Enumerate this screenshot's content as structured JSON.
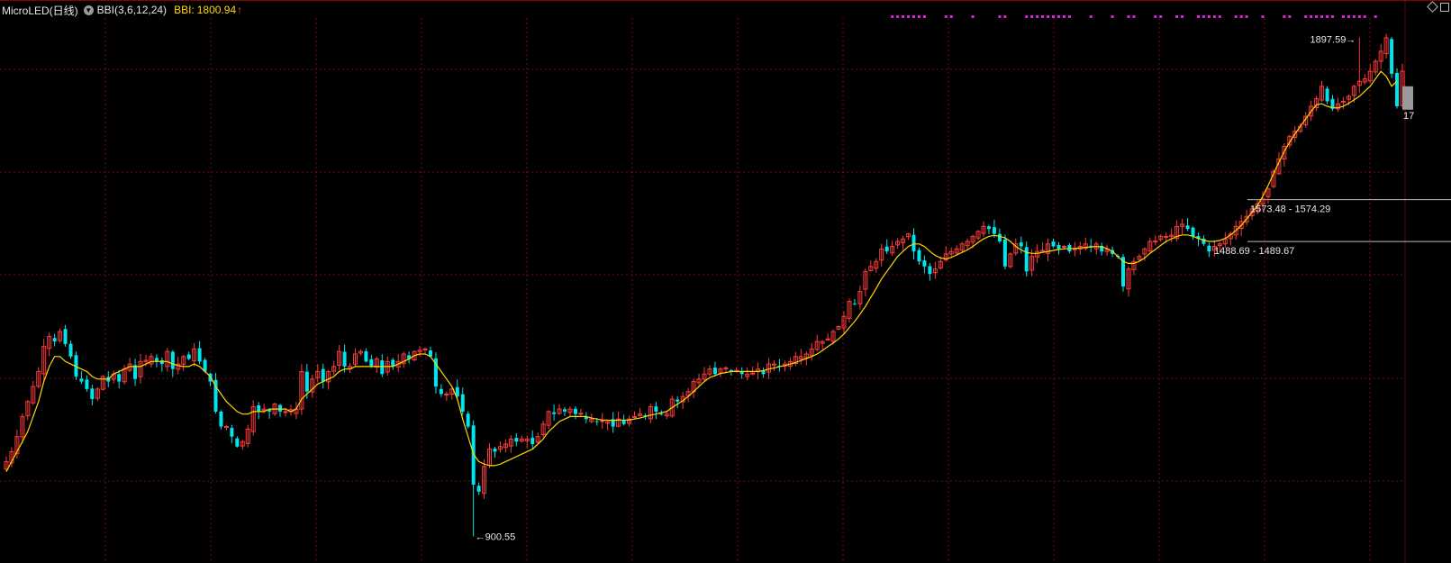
{
  "header": {
    "title": "MicroLED(日线)",
    "indicator_icon": "chevron-down-icon",
    "indicator": "BBI(3,6,12,24)",
    "bbi_label": "BBI:",
    "bbi_value": "1800.94",
    "bbi_arrow": "↑"
  },
  "corner_icons": [
    "diamond-icon",
    "square-icon"
  ],
  "colors": {
    "background": "#000000",
    "grid": "#7a0d0d",
    "up": "#ff3b3b",
    "down": "#00e5ee",
    "bbi": "#ffd700",
    "signal_dots": "#e020e0",
    "text": "#e6e6e6"
  },
  "chart_data": {
    "type": "candlestick",
    "ylim": [
      860,
      1940
    ],
    "grid": true,
    "annotations": {
      "high": "1897.59",
      "low": "900.55",
      "zone1": "1573.48 - 1574.29",
      "zone2": "1488.69 - 1489.67",
      "right_edge_label": "17"
    },
    "levels": [
      1573.48,
      1489.67
    ],
    "low_index": 87,
    "high_index": 252,
    "close": [
      1050,
      1070,
      1100,
      1140,
      1170,
      1200,
      1230,
      1280,
      1300,
      1290,
      1310,
      1285,
      1260,
      1220,
      1210,
      1195,
      1175,
      1195,
      1220,
      1210,
      1225,
      1210,
      1235,
      1245,
      1215,
      1250,
      1250,
      1260,
      1250,
      1245,
      1270,
      1235,
      1245,
      1260,
      1255,
      1275,
      1250,
      1230,
      1210,
      1150,
      1120,
      1120,
      1100,
      1080,
      1090,
      1115,
      1160,
      1150,
      1155,
      1150,
      1165,
      1150,
      1150,
      1150,
      1155,
      1230,
      1190,
      1215,
      1230,
      1210,
      1230,
      1240,
      1270,
      1240,
      1240,
      1265,
      1270,
      1250,
      1240,
      1255,
      1225,
      1250,
      1240,
      1250,
      1265,
      1255,
      1270,
      1270,
      1275,
      1260,
      1200,
      1185,
      1185,
      1195,
      1180,
      1150,
      1120,
      1004,
      990,
      1040,
      1075,
      1070,
      1080,
      1085,
      1095,
      1090,
      1095,
      1095,
      1085,
      1100,
      1125,
      1150,
      1145,
      1155,
      1150,
      1155,
      1145,
      1145,
      1135,
      1135,
      1130,
      1130,
      1130,
      1120,
      1135,
      1125,
      1135,
      1140,
      1145,
      1140,
      1160,
      1150,
      1145,
      1145,
      1175,
      1170,
      1180,
      1190,
      1210,
      1215,
      1225,
      1235,
      1225,
      1235,
      1235,
      1230,
      1230,
      1225,
      1225,
      1225,
      1235,
      1225,
      1245,
      1245,
      1240,
      1245,
      1250,
      1260,
      1260,
      1265,
      1275,
      1290,
      1290,
      1295,
      1310,
      1320,
      1340,
      1370,
      1365,
      1390,
      1430,
      1440,
      1450,
      1475,
      1470,
      1480,
      1490,
      1495,
      1505,
      1470,
      1450,
      1440,
      1425,
      1435,
      1450,
      1465,
      1470,
      1475,
      1485,
      1490,
      1500,
      1510,
      1520,
      1515,
      1505,
      1490,
      1440,
      1465,
      1485,
      1480,
      1430,
      1460,
      1470,
      1470,
      1485,
      1480,
      1475,
      1480,
      1470,
      1475,
      1480,
      1485,
      1480,
      1485,
      1470,
      1470,
      1465,
      1460,
      1400,
      1435,
      1450,
      1460,
      1475,
      1490,
      1490,
      1500,
      1500,
      1500,
      1520,
      1520,
      1515,
      1500,
      1495,
      1485,
      1470,
      1480,
      1485,
      1495,
      1505,
      1520,
      1530,
      1540,
      1555,
      1565,
      1575,
      1595,
      1630,
      1655,
      1680,
      1700,
      1710,
      1720,
      1740,
      1760,
      1775,
      1800,
      1770,
      1755,
      1765,
      1770,
      1780,
      1800,
      1810,
      1815,
      1830,
      1850,
      1870,
      1897,
      1825,
      1760,
      1830
    ],
    "bbi": [
      1030,
      1050,
      1070,
      1090,
      1110,
      1140,
      1170,
      1210,
      1240,
      1260,
      1260,
      1250,
      1245,
      1240,
      1235,
      1230,
      1220,
      1215,
      1215,
      1215,
      1225,
      1230,
      1235,
      1240,
      1240,
      1240,
      1245,
      1250,
      1250,
      1250,
      1250,
      1245,
      1242,
      1240,
      1240,
      1245,
      1240,
      1230,
      1220,
      1200,
      1185,
      1170,
      1160,
      1150,
      1145,
      1145,
      1150,
      1150,
      1150,
      1155,
      1155,
      1155,
      1155,
      1150,
      1155,
      1175,
      1185,
      1195,
      1205,
      1210,
      1215,
      1220,
      1230,
      1235,
      1235,
      1240,
      1240,
      1240,
      1240,
      1240,
      1240,
      1240,
      1240,
      1245,
      1250,
      1255,
      1262,
      1265,
      1265,
      1260,
      1245,
      1230,
      1215,
      1200,
      1175,
      1135,
      1100,
      1065,
      1050,
      1045,
      1042,
      1042,
      1045,
      1050,
      1055,
      1060,
      1065,
      1070,
      1075,
      1085,
      1095,
      1110,
      1120,
      1130,
      1135,
      1140,
      1140,
      1140,
      1140,
      1137,
      1135,
      1133,
      1133,
      1132,
      1133,
      1133,
      1133,
      1135,
      1137,
      1140,
      1143,
      1145,
      1148,
      1150,
      1158,
      1165,
      1172,
      1180,
      1190,
      1200,
      1210,
      1218,
      1222,
      1226,
      1228,
      1230,
      1230,
      1230,
      1230,
      1230,
      1230,
      1232,
      1235,
      1237,
      1240,
      1242,
      1245,
      1248,
      1252,
      1256,
      1260,
      1265,
      1272,
      1280,
      1287,
      1295,
      1305,
      1318,
      1330,
      1345,
      1360,
      1378,
      1396,
      1415,
      1430,
      1445,
      1460,
      1470,
      1480,
      1485,
      1485,
      1480,
      1470,
      1462,
      1457,
      1455,
      1458,
      1463,
      1468,
      1473,
      1480,
      1488,
      1495,
      1500,
      1502,
      1500,
      1497,
      1490,
      1480,
      1473,
      1468,
      1466,
      1466,
      1468,
      1470,
      1472,
      1474,
      1475,
      1476,
      1476,
      1477,
      1478,
      1479,
      1480,
      1479,
      1476,
      1470,
      1460,
      1450,
      1446,
      1446,
      1450,
      1457,
      1466,
      1474,
      1482,
      1490,
      1495,
      1500,
      1503,
      1503,
      1500,
      1496,
      1492,
      1490,
      1490,
      1492,
      1496,
      1503,
      1512,
      1522,
      1535,
      1548,
      1562,
      1580,
      1602,
      1625,
      1648,
      1670,
      1688,
      1705,
      1720,
      1735,
      1750,
      1763,
      1765,
      1760,
      1757,
      1757,
      1760,
      1766,
      1773,
      1780,
      1790,
      1800,
      1815,
      1830,
      1820,
      1800,
      1810
    ],
    "signal_dot_indices": [
      165,
      166,
      167,
      168,
      169,
      170,
      171,
      175,
      176,
      180,
      185,
      186,
      190,
      191,
      192,
      193,
      194,
      195,
      196,
      197,
      198,
      202,
      206,
      209,
      210,
      214,
      215,
      218,
      219,
      222,
      223,
      224,
      225,
      226,
      229,
      230,
      231,
      234,
      238,
      239,
      242,
      243,
      244,
      245,
      246,
      247,
      249,
      250,
      251,
      252,
      253,
      255
    ]
  }
}
